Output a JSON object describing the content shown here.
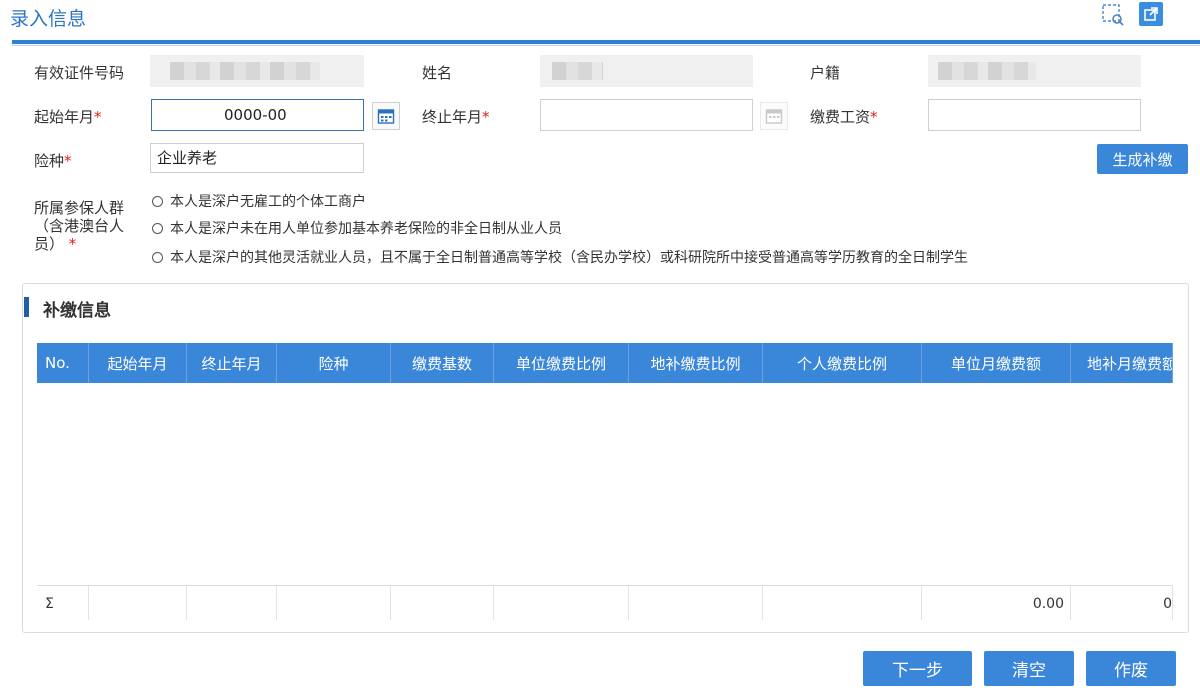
{
  "window": {
    "title": "录入信息"
  },
  "fields": {
    "id_label": "有效证件号码",
    "name_label": "姓名",
    "household_label": "户籍",
    "start_label": "起始年月",
    "start_value": "0000-00",
    "end_label": "终止年月",
    "end_value": "",
    "wage_label": "缴费工资",
    "wage_value": "",
    "insurance_label": "险种",
    "insurance_value": "企业养老",
    "group_label_1": "所属参保人群",
    "group_label_2": "（含港澳台人",
    "group_label_3": "员）",
    "required_mark": "*"
  },
  "actions": {
    "generate": "生成补缴"
  },
  "radios": [
    "本人是深户无雇工的个体工商户",
    "本人是深户未在用人单位参加基本养老保险的非全日制从业人员",
    "本人是深户的其他灵活就业人员，且不属于全日制普通高等学校（含民办学校）或科研院所中接受普通高等学历教育的全日制学生"
  ],
  "panel": {
    "title": "补缴信息"
  },
  "table": {
    "headers": [
      "No.",
      "起始年月",
      "终止年月",
      "险种",
      "缴费基数",
      "单位缴费比例",
      "地补缴费比例",
      "个人缴费比例",
      "单位月缴费额",
      "地补月缴费额"
    ],
    "sum_symbol": "Σ",
    "sum_values": [
      "",
      "",
      "",
      "",
      "",
      "",
      "",
      "",
      "0.00",
      "0"
    ]
  },
  "footer": {
    "next": "下一步",
    "clear": "清空",
    "void": "作废"
  },
  "colors": {
    "accent": "#3a86d8",
    "title": "#2b74c6",
    "required": "#e0211a"
  },
  "icons": {
    "expand": "expand-icon",
    "popout": "popout-icon",
    "calendar": "calendar-icon"
  }
}
